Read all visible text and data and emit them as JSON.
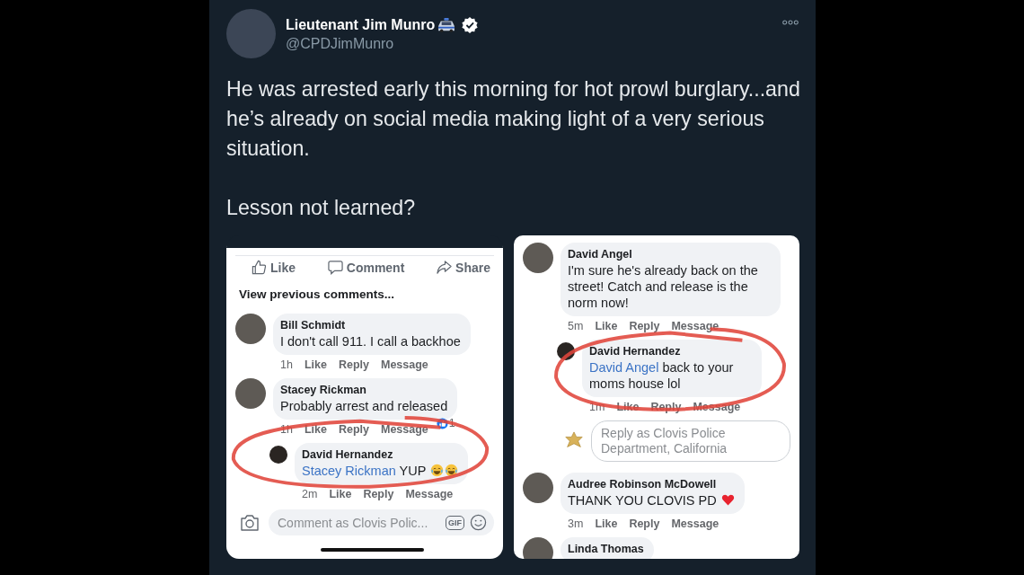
{
  "tweet": {
    "author_name": "Lieutenant Jim Munro",
    "handle": "@CPDJimMunro",
    "verified": true,
    "paragraphs": [
      "He was arrested early this morning for hot prowl burglary...and he’s already on social media making light of a very serious situation.",
      "Lesson not learned?"
    ]
  },
  "panels": [
    {
      "actions": [
        {
          "kind": "like",
          "label": "Like"
        },
        {
          "kind": "comment",
          "label": "Comment"
        },
        {
          "kind": "share",
          "label": "Share"
        }
      ],
      "view_previous": "View previous comments...",
      "comments": [
        {
          "kind": "comment",
          "author": "Bill Schmidt",
          "text": "I don't call 911. I call a backhoe",
          "time": "1h",
          "actions": [
            "Like",
            "Reply",
            "Message"
          ],
          "circled": false
        },
        {
          "kind": "comment",
          "author": "Stacey Rickman",
          "text": "Probably arrest and released",
          "time": "1h",
          "actions": [
            "Like",
            "Reply",
            "Message"
          ],
          "reaction_count": "1",
          "circled": false
        },
        {
          "kind": "reply",
          "author": "David Hernandez",
          "mention": "Stacey Rickman",
          "text": "YUP",
          "emojis": [
            {
              "kind": "laughing"
            },
            {
              "kind": "laughing"
            }
          ],
          "time": "2m",
          "actions": [
            "Like",
            "Reply",
            "Message"
          ],
          "circled": true
        }
      ],
      "composer": {
        "placeholder": "Comment as Clovis Polic...",
        "gif": "GIF"
      }
    },
    {
      "comments": [
        {
          "kind": "comment",
          "author": "David Angel",
          "text": "I'm sure he's already back on the street! Catch and release is the norm now!",
          "time": "5m",
          "actions": [
            "Like",
            "Reply",
            "Message"
          ],
          "circled": false
        },
        {
          "kind": "reply",
          "author": "David Hernandez",
          "mention": "David Angel",
          "text": "back to your moms house lol",
          "time": "1m",
          "actions": [
            "Like",
            "Reply",
            "Message"
          ],
          "circled": true
        },
        {
          "kind": "reply_field",
          "placeholder": "Reply as Clovis Police Department, California"
        },
        {
          "kind": "comment",
          "author": "Audree Robinson McDowell",
          "text": "THANK YOU CLOVIS PD",
          "emojis": [
            {
              "kind": "heart"
            }
          ],
          "time": "3m",
          "actions": [
            "Like",
            "Reply",
            "Message"
          ],
          "circled": false
        },
        {
          "kind": "comment",
          "author": "Linda Thomas",
          "circled": false
        }
      ]
    }
  ]
}
